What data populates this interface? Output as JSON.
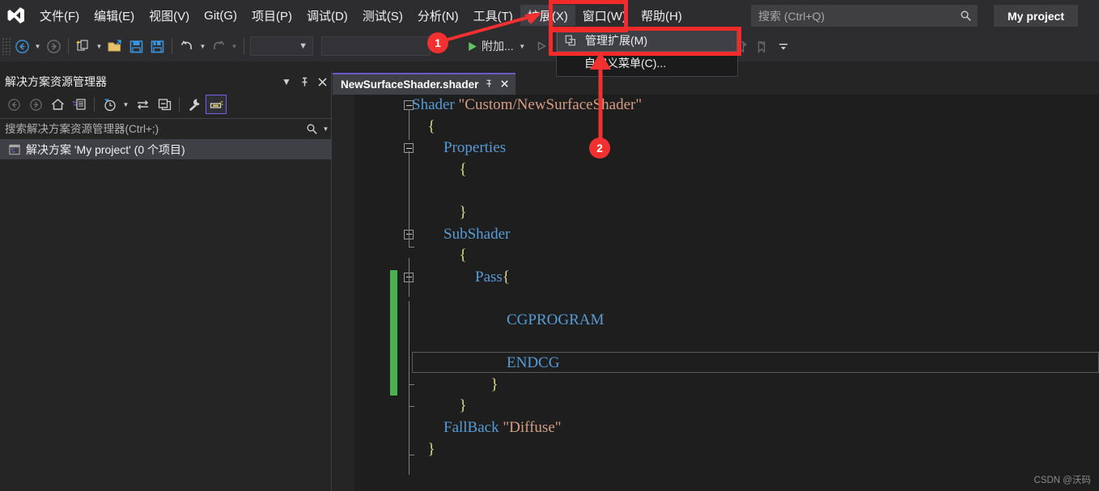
{
  "app": {
    "project_title": "My project",
    "watermark": "CSDN @沃码"
  },
  "menubar": {
    "logo_icon": "visual-studio-logo",
    "items": [
      {
        "label": "文件(F)"
      },
      {
        "label": "编辑(E)"
      },
      {
        "label": "视图(V)"
      },
      {
        "label": "Git(G)"
      },
      {
        "label": "项目(P)"
      },
      {
        "label": "调试(D)"
      },
      {
        "label": "测试(S)"
      },
      {
        "label": "分析(N)"
      },
      {
        "label": "工具(T)"
      },
      {
        "label": "扩展(X)"
      },
      {
        "label": "窗口(W)"
      },
      {
        "label": "帮助(H)"
      }
    ],
    "search": {
      "placeholder": "搜索 (Ctrl+Q)",
      "value": "",
      "icon": "search-icon"
    }
  },
  "dropdown": {
    "items": [
      {
        "label": "管理扩展(M)",
        "icon": "manage-extensions-icon",
        "hovered": true
      },
      {
        "label": "自定义菜单(C)...",
        "icon": "",
        "hovered": false
      }
    ]
  },
  "toolbar": {
    "back_icon": "navigate-back-icon",
    "forward_icon": "navigate-forward-icon",
    "new_project_icon": "new-project-icon",
    "open_file_icon": "open-file-icon",
    "save_icon": "save-icon",
    "save_all_icon": "save-all-icon",
    "undo_icon": "undo-icon",
    "redo_icon": "redo-icon",
    "config_combo": "",
    "platform_combo": "",
    "run_label": "附加...",
    "run_icon": "start-debug-icon",
    "run_alt_icon": "start-no-debug-icon",
    "bookmark_icon": "bookmark-icon",
    "prev_bookmark_icon": "previous-bookmark-icon",
    "next_bookmark_icon": "next-bookmark-icon",
    "clear_bookmark_icon": "clear-bookmarks-icon",
    "overflow_icon": "toolbar-overflow-icon"
  },
  "solution_explorer": {
    "title": "解决方案资源管理器",
    "header_buttons": [
      {
        "icon": "chevron-down-icon"
      },
      {
        "icon": "pin-icon"
      },
      {
        "icon": "close-icon"
      }
    ],
    "toolbar_icons": [
      {
        "icon": "back-icon"
      },
      {
        "icon": "forward-icon"
      },
      {
        "icon": "home-icon"
      },
      {
        "icon": "solution-explorer-icon"
      },
      {
        "icon": "pending-changes-icon"
      },
      {
        "icon": "sync-with-active-document-icon"
      },
      {
        "icon": "collapse-all-icon"
      },
      {
        "icon": "properties-wrench-icon"
      },
      {
        "icon": "preview-selected-items-icon"
      }
    ],
    "search": {
      "placeholder": "搜索解决方案资源管理器(Ctrl+;)",
      "value": "",
      "icon": "search-icon"
    },
    "tree": [
      {
        "label": "解决方案 'My project' (0 个项目)",
        "icon": "solution-icon",
        "selected": true
      }
    ]
  },
  "editor": {
    "tab": {
      "label": "NewSurfaceShader.shader",
      "pin_icon": "pin-icon",
      "close_icon": "close-icon"
    },
    "current_line_index": 12,
    "lines": [
      {
        "indent": 0,
        "fold": "minus",
        "tokens": [
          {
            "t": "Shader",
            "c": "kw"
          },
          {
            "t": " ",
            "c": ""
          },
          {
            "t": "\"Custom/NewSurfaceShader\"",
            "c": "str"
          }
        ]
      },
      {
        "indent": 1,
        "fold": "",
        "tokens": [
          {
            "t": "{",
            "c": "brc"
          }
        ]
      },
      {
        "indent": 2,
        "fold": "minus",
        "tokens": [
          {
            "t": "Properties",
            "c": "kw"
          }
        ]
      },
      {
        "indent": 3,
        "fold": "",
        "tokens": [
          {
            "t": "{",
            "c": "brc"
          }
        ]
      },
      {
        "indent": 0,
        "fold": "",
        "tokens": []
      },
      {
        "indent": 3,
        "fold": "",
        "tokens": [
          {
            "t": "}",
            "c": "brc"
          }
        ]
      },
      {
        "indent": 2,
        "fold": "minus",
        "tokens": [
          {
            "t": "SubShader",
            "c": "kw"
          }
        ]
      },
      {
        "indent": 3,
        "fold": "",
        "tokens": [
          {
            "t": "{",
            "c": "brc"
          }
        ]
      },
      {
        "indent": 4,
        "fold": "minus",
        "tokens": [
          {
            "t": "Pass",
            "c": "kw"
          },
          {
            "t": "{",
            "c": "brc"
          }
        ]
      },
      {
        "indent": 0,
        "fold": "",
        "tokens": []
      },
      {
        "indent": 6,
        "fold": "",
        "tokens": [
          {
            "t": "CGPROGRAM",
            "c": "kw"
          }
        ]
      },
      {
        "indent": 0,
        "fold": "",
        "tokens": []
      },
      {
        "indent": 6,
        "fold": "",
        "tokens": [
          {
            "t": "ENDCG",
            "c": "kw"
          }
        ]
      },
      {
        "indent": 5,
        "fold": "",
        "tokens": [
          {
            "t": "}",
            "c": "brc"
          }
        ]
      },
      {
        "indent": 3,
        "fold": "",
        "tokens": [
          {
            "t": "}",
            "c": "brc"
          }
        ]
      },
      {
        "indent": 2,
        "fold": "",
        "tokens": [
          {
            "t": "FallBack",
            "c": "kw"
          },
          {
            "t": " ",
            "c": ""
          },
          {
            "t": "\"Diffuse\"",
            "c": "str"
          }
        ]
      },
      {
        "indent": 1,
        "fold": "",
        "tokens": [
          {
            "t": "}",
            "c": "brc"
          }
        ]
      }
    ],
    "change_bar_color": "#4caf50"
  },
  "annotations": {
    "accent_color": "#f23030",
    "badges": [
      {
        "label": "1",
        "target": "扩展(X)"
      },
      {
        "label": "2",
        "target": "管理扩展(M)"
      }
    ],
    "boxes": [
      {
        "target": "扩展(X)"
      },
      {
        "target": "管理扩展(M)"
      }
    ]
  }
}
